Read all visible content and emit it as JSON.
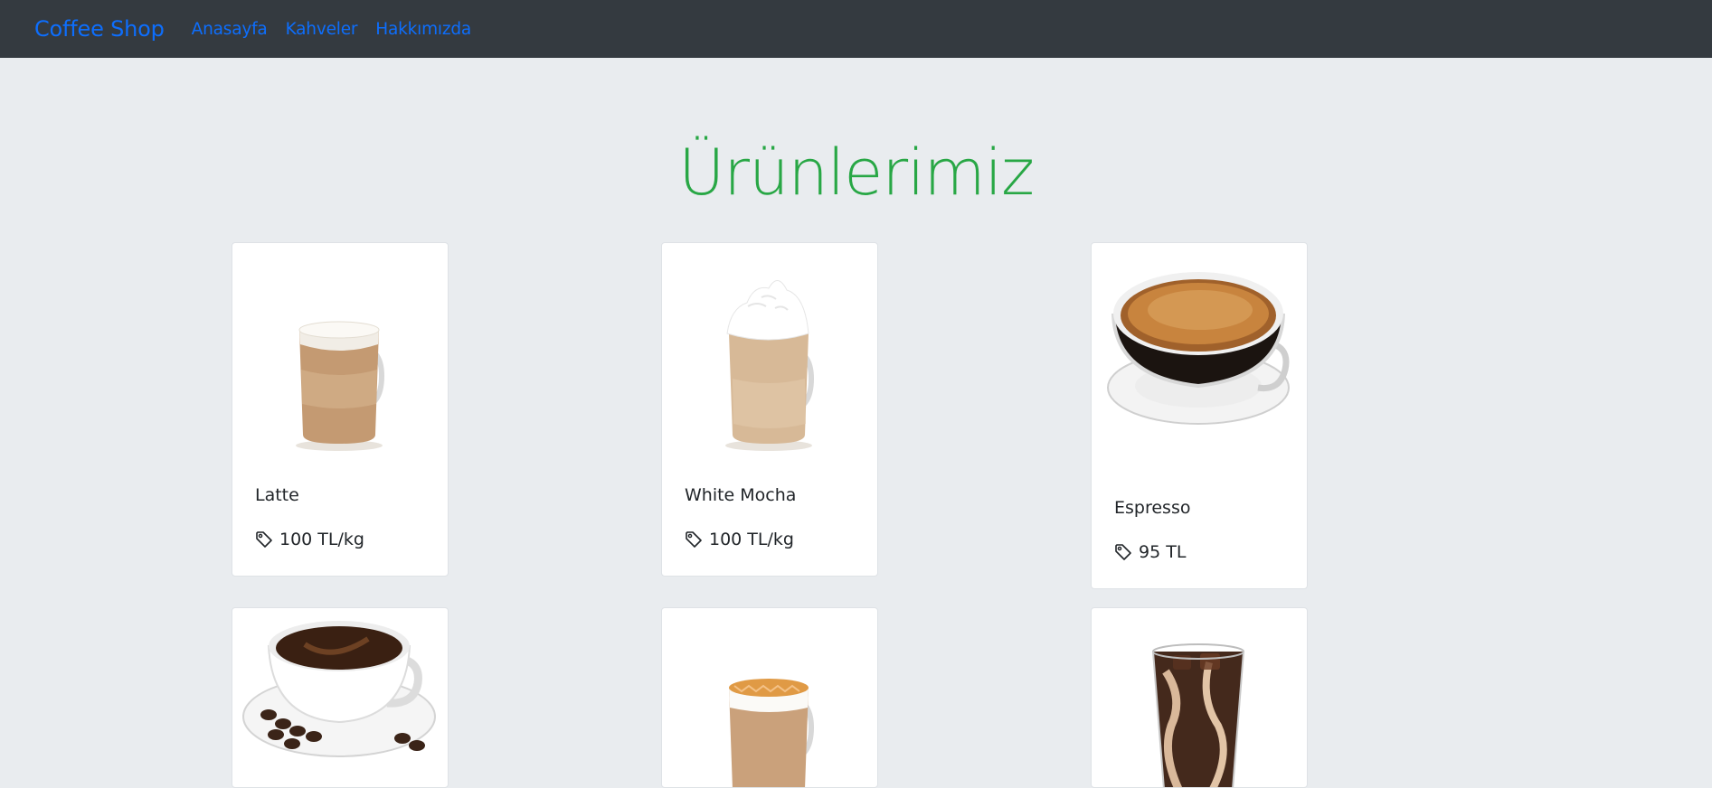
{
  "navbar": {
    "brand": "Coffee Shop",
    "links": [
      "Anasayfa",
      "Kahveler",
      "Hakkımızda"
    ]
  },
  "page_title": "Ürünlerimiz",
  "products": [
    {
      "name": "Latte",
      "price": "100 TL/kg",
      "image": "latte-mug"
    },
    {
      "name": "White Mocha",
      "price": "100 TL/kg",
      "image": "white-mocha-mug"
    },
    {
      "name": "Espresso",
      "price": "95 TL",
      "image": "espresso-cup"
    },
    {
      "name": "",
      "price": "",
      "image": "coffee-cup-with-beans"
    },
    {
      "name": "",
      "price": "",
      "image": "caramel-macchiato-mug"
    },
    {
      "name": "",
      "price": "",
      "image": "iced-coffee-glass"
    }
  ],
  "colors": {
    "navbar_bg": "#343a40",
    "link": "#0d6efd",
    "title": "#28a745",
    "page_bg": "#e9ecef"
  }
}
